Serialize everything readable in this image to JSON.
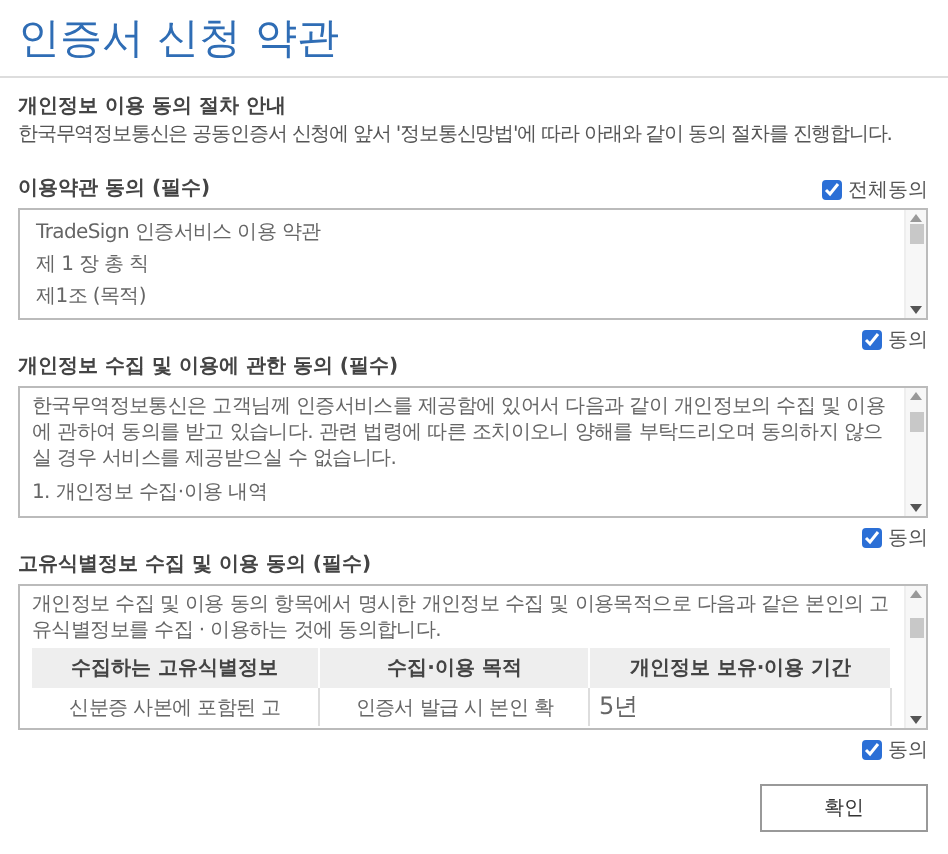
{
  "title": "인증서 신청 약관",
  "intro": {
    "heading": "개인정보 이용 동의 절차 안내",
    "text": "한국무역정보통신은 공동인증서 신청에 앞서 '정보통신망법'에 따라 아래와 같이 동의 절차를 진행합니다."
  },
  "all_agree": {
    "label": "전체동의",
    "checked": true
  },
  "sections": [
    {
      "kind": "text",
      "heading": "이용약관 동의 (필수)",
      "lines": [
        "TradeSign 인증서비스 이용 약관",
        "제 1 장 총 칙",
        "제1조 (목적)"
      ],
      "agree": {
        "label": "동의",
        "checked": true
      }
    },
    {
      "kind": "text",
      "heading": "개인정보 수집 및 이용에 관한 동의 (필수)",
      "lines": [
        "한국무역정보통신은 고객님께 인증서비스를 제공함에 있어서 다음과 같이 개인정보의 수집 및 이용에 관하여 동의를 받고 있습니다. 관련 법령에 따른 조치이오니 양해를 부탁드리오며 동의하지 않으실 경우 서비스를 제공받으실 수 없습니다.",
        "1. 개인정보 수집·이용 내역"
      ],
      "agree": {
        "label": "동의",
        "checked": true
      }
    },
    {
      "kind": "table",
      "heading": "고유식별정보 수집 및 이용 동의 (필수)",
      "lines": [
        "개인정보 수집 및 이용 동의 항목에서 명시한 개인정보 수집 및 이용목적으로 다음과 같은 본인의 고유식별정보를 수집 · 이용하는 것에 동의합니다."
      ],
      "table": {
        "columns": [
          "수집하는 고유식별정보",
          "수집·이용 목적",
          "개인정보 보유·이용 기간"
        ],
        "rows": [
          [
            "신분증 사본에 포함된 고",
            "인증서 발급 시 본인 확",
            "5년"
          ]
        ]
      },
      "agree": {
        "label": "동의",
        "checked": true
      }
    }
  ],
  "confirm_button": "확인"
}
